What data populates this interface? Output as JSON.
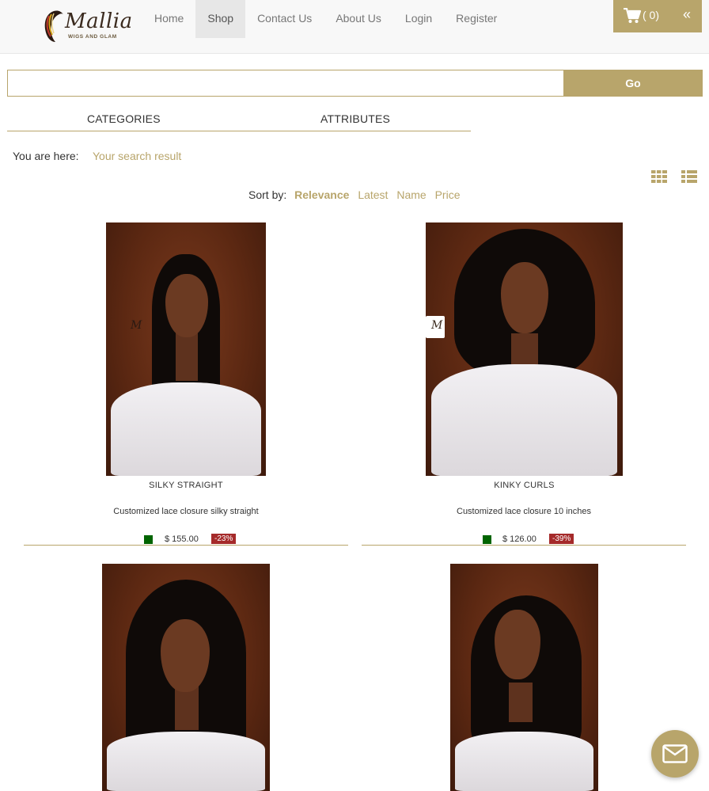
{
  "brand": {
    "name": "Mallia",
    "tagline": "WIGS AND GLAM"
  },
  "nav": {
    "items": [
      {
        "label": "Home"
      },
      {
        "label": "Shop",
        "active": true
      },
      {
        "label": "Contact Us"
      },
      {
        "label": "About Us"
      },
      {
        "label": "Login"
      },
      {
        "label": "Register"
      }
    ]
  },
  "cart": {
    "count_label": "( 0)",
    "icon": "shopping-cart-icon",
    "collapse_icon": "double-chevron-left-icon",
    "collapse_label": "«"
  },
  "search": {
    "value": "",
    "placeholder": "",
    "button_label": "Go"
  },
  "filters": {
    "categories_label": "CATEGORIES",
    "attributes_label": "ATTRIBUTES"
  },
  "breadcrumb": {
    "label": "You are here:",
    "current": "Your search result"
  },
  "view_toggles": {
    "grid_icon": "grid-view-icon",
    "list_icon": "list-view-icon"
  },
  "sort": {
    "label": "Sort by:",
    "options": [
      "Relevance",
      "Latest",
      "Name",
      "Price"
    ],
    "selected": "Relevance"
  },
  "products": [
    {
      "title": "SILKY STRAIGHT",
      "description": "Customized lace closure silky straight",
      "price": "$ 155.00",
      "discount": "-23%",
      "in_stock": true
    },
    {
      "title": "KINKY CURLS",
      "description": "Customized lace closure 10 inches",
      "price": "$ 126.00",
      "discount": "-39%",
      "in_stock": true
    },
    {
      "title": "",
      "description": "",
      "price": "",
      "discount": ""
    },
    {
      "title": "",
      "description": "",
      "price": "",
      "discount": ""
    }
  ],
  "chat": {
    "icon": "envelope-icon"
  },
  "colors": {
    "accent": "#b8a56b",
    "stock": "#006400",
    "discount": "#a52a2a",
    "header_bg": "#f8f8f8"
  }
}
